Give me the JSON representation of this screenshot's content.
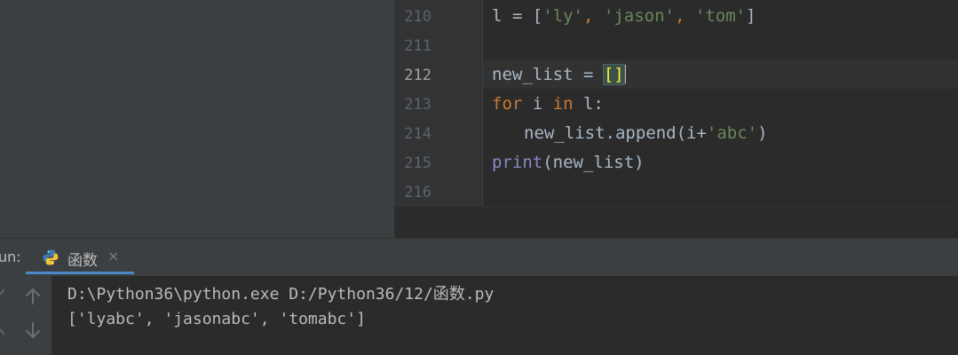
{
  "editor": {
    "line_numbers": [
      "210",
      "211",
      "212",
      "213",
      "214",
      "215",
      "216"
    ],
    "current_line": "212",
    "code": {
      "l210": {
        "var": "l",
        "op": " = [",
        "s1": "'ly'",
        "sep1": ", ",
        "s2": "'jason'",
        "sep2": ", ",
        "s3": "'tom'",
        "close": "]"
      },
      "l212": {
        "var": "new_list",
        "op": " = ",
        "brackets": "[]"
      },
      "l213": {
        "kw_for": "for",
        "mid": " i ",
        "kw_in": "in",
        "rest": " l:"
      },
      "l214": {
        "call": "new_list.append(i+",
        "arg": "'abc'",
        "close": ")"
      },
      "l215": {
        "builtin": "print",
        "rest": "(new_list)"
      }
    }
  },
  "run_panel": {
    "label": "un:",
    "tab": {
      "label": "函数",
      "close": "×",
      "icon": "python-icon"
    },
    "toolbar": {
      "up_icon": "arrow-up-icon",
      "down_icon": "arrow-down-icon"
    },
    "console": {
      "command": "D:\\Python36\\python.exe D:/Python36/12/函数.py",
      "output": "['lyabc', 'jasonabc', 'tomabc']"
    }
  },
  "colors": {
    "keyword": "#cc7832",
    "string": "#6a8759",
    "builtin": "#8888c6",
    "text": "#a9b7c6",
    "bracket_match": "#ffef28",
    "tab_underline": "#4a88c7"
  }
}
